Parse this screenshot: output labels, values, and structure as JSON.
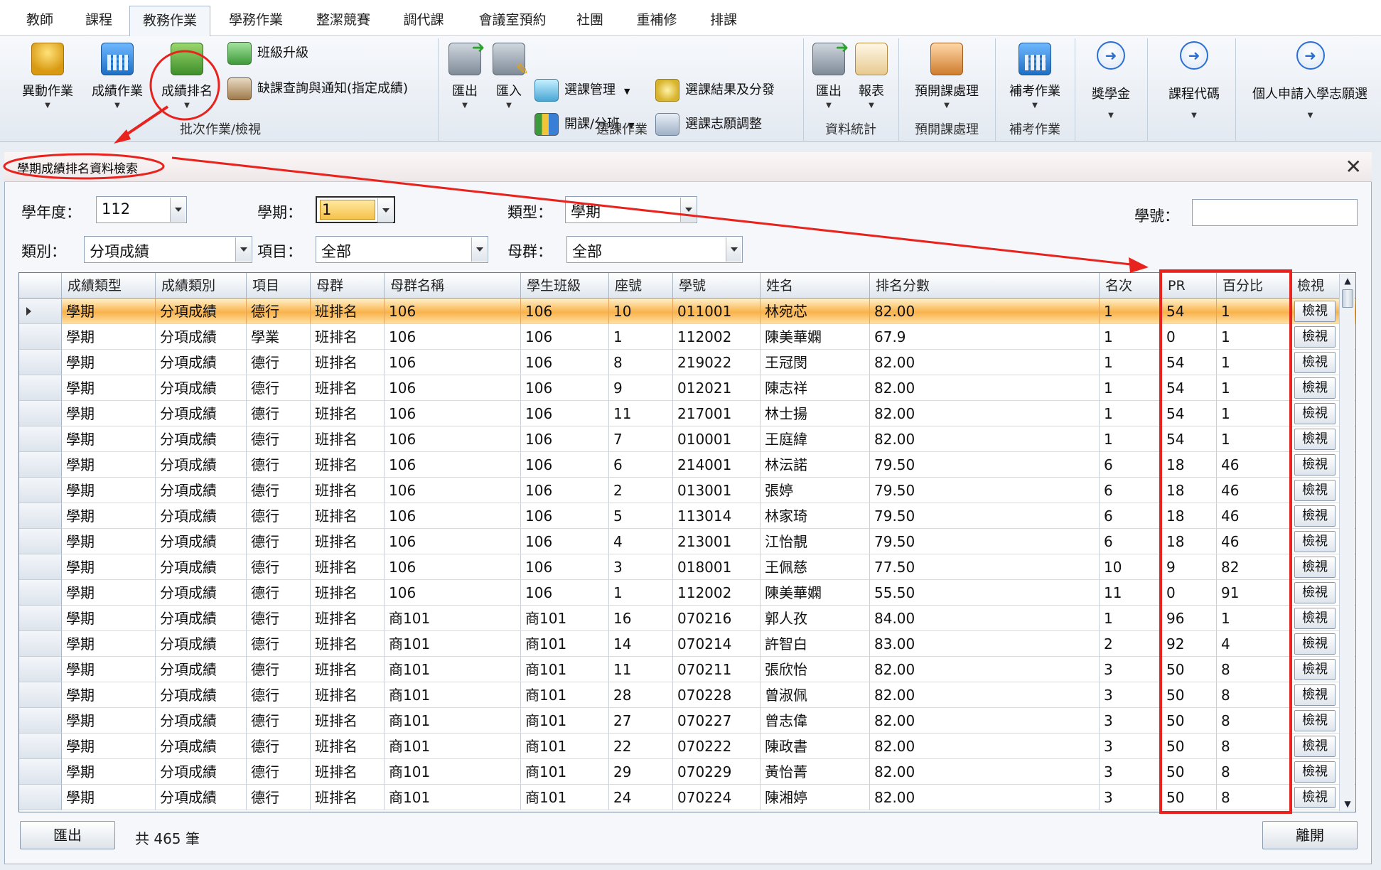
{
  "menu": {
    "tabs": [
      "教師",
      "課程",
      "教務作業",
      "學務作業",
      "整潔競賽",
      "調代課",
      "會議室預約",
      "社團",
      "重補修",
      "排課"
    ],
    "active_index": 2
  },
  "ribbon": {
    "batch_group": {
      "title": "批次作業/檢視",
      "change_op": "異動作業",
      "grade_op": "成績作業",
      "grade_rank": "成績排名",
      "class_promote": "班級升級",
      "absence_query": "缺課查詢與通知(指定成績)"
    },
    "course_group": {
      "title": "選課作業",
      "export": "匯出",
      "import": "匯入",
      "course_manage": "選課管理",
      "open_class": "開課/分班",
      "result_assign": "選課結果及分發",
      "wish_adjust": "選課志願調整"
    },
    "stats_group": {
      "title": "資料統計",
      "export": "匯出",
      "report": "報表"
    },
    "pre_group": {
      "title": "預開課處理",
      "pre_course": "預開課處理"
    },
    "makeup_group": {
      "title": "補考作業",
      "makeup": "補考作業"
    },
    "scholarship": "獎學金",
    "course_code": "課程代碼",
    "personal_apply": "個人申請入學志願選"
  },
  "panel": {
    "title": "學期成績排名資料檢索",
    "filters": {
      "year_label": "學年度：",
      "year_value": "112",
      "semester_label": "學期：",
      "semester_value": "1",
      "type_label": "類型：",
      "type_value": "學期",
      "student_no_label": "學號：",
      "student_no_value": "",
      "category_label": "類別：",
      "category_value": "分項成績",
      "item_label": "項目：",
      "item_value": "全部",
      "parent_label": "母群：",
      "parent_value": "全部"
    },
    "grid": {
      "columns": [
        "成績類型",
        "成績類別",
        "項目",
        "母群",
        "母群名稱",
        "學生班級",
        "座號",
        "學號",
        "姓名",
        "排名分數",
        "名次",
        "PR",
        "百分比",
        "檢視"
      ],
      "view_label": "檢視",
      "rows": [
        [
          "學期",
          "分項成績",
          "德行",
          "班排名",
          "106",
          "106",
          "10",
          "011001",
          "林宛芯",
          "82.00",
          "1",
          "54",
          "1"
        ],
        [
          "學期",
          "分項成績",
          "學業",
          "班排名",
          "106",
          "106",
          "1",
          "112002",
          "陳美華嫻",
          "67.9",
          "1",
          "0",
          "1"
        ],
        [
          "學期",
          "分項成績",
          "德行",
          "班排名",
          "106",
          "106",
          "8",
          "219022",
          "王冠閔",
          "82.00",
          "1",
          "54",
          "1"
        ],
        [
          "學期",
          "分項成績",
          "德行",
          "班排名",
          "106",
          "106",
          "9",
          "012021",
          "陳志祥",
          "82.00",
          "1",
          "54",
          "1"
        ],
        [
          "學期",
          "分項成績",
          "德行",
          "班排名",
          "106",
          "106",
          "11",
          "217001",
          "林士揚",
          "82.00",
          "1",
          "54",
          "1"
        ],
        [
          "學期",
          "分項成績",
          "德行",
          "班排名",
          "106",
          "106",
          "7",
          "010001",
          "王庭緯",
          "82.00",
          "1",
          "54",
          "1"
        ],
        [
          "學期",
          "分項成績",
          "德行",
          "班排名",
          "106",
          "106",
          "6",
          "214001",
          "林沄諾",
          "79.50",
          "6",
          "18",
          "46"
        ],
        [
          "學期",
          "分項成績",
          "德行",
          "班排名",
          "106",
          "106",
          "2",
          "013001",
          "張婷",
          "79.50",
          "6",
          "18",
          "46"
        ],
        [
          "學期",
          "分項成績",
          "德行",
          "班排名",
          "106",
          "106",
          "5",
          "113014",
          "林家琦",
          "79.50",
          "6",
          "18",
          "46"
        ],
        [
          "學期",
          "分項成績",
          "德行",
          "班排名",
          "106",
          "106",
          "4",
          "213001",
          "江怡靚",
          "79.50",
          "6",
          "18",
          "46"
        ],
        [
          "學期",
          "分項成績",
          "德行",
          "班排名",
          "106",
          "106",
          "3",
          "018001",
          "王佩慈",
          "77.50",
          "10",
          "9",
          "82"
        ],
        [
          "學期",
          "分項成績",
          "德行",
          "班排名",
          "106",
          "106",
          "1",
          "112002",
          "陳美華嫻",
          "55.50",
          "11",
          "0",
          "91"
        ],
        [
          "學期",
          "分項成績",
          "德行",
          "班排名",
          "商101",
          "商101",
          "16",
          "070216",
          "郭人孜",
          "84.00",
          "1",
          "96",
          "1"
        ],
        [
          "學期",
          "分項成績",
          "德行",
          "班排名",
          "商101",
          "商101",
          "14",
          "070214",
          "許智白",
          "83.00",
          "2",
          "92",
          "4"
        ],
        [
          "學期",
          "分項成績",
          "德行",
          "班排名",
          "商101",
          "商101",
          "11",
          "070211",
          "張欣怡",
          "82.00",
          "3",
          "50",
          "8"
        ],
        [
          "學期",
          "分項成績",
          "德行",
          "班排名",
          "商101",
          "商101",
          "28",
          "070228",
          "曾淑佩",
          "82.00",
          "3",
          "50",
          "8"
        ],
        [
          "學期",
          "分項成績",
          "德行",
          "班排名",
          "商101",
          "商101",
          "27",
          "070227",
          "曾志偉",
          "82.00",
          "3",
          "50",
          "8"
        ],
        [
          "學期",
          "分項成績",
          "德行",
          "班排名",
          "商101",
          "商101",
          "22",
          "070222",
          "陳政書",
          "82.00",
          "3",
          "50",
          "8"
        ],
        [
          "學期",
          "分項成績",
          "德行",
          "班排名",
          "商101",
          "商101",
          "29",
          "070229",
          "黃怡菁",
          "82.00",
          "3",
          "50",
          "8"
        ],
        [
          "學期",
          "分項成績",
          "德行",
          "班排名",
          "商101",
          "商101",
          "24",
          "070224",
          "陳湘婷",
          "82.00",
          "3",
          "50",
          "8"
        ]
      ]
    },
    "footer": {
      "export": "匯出",
      "count": "共 465 筆",
      "leave": "離開"
    }
  },
  "colors": {
    "annotation_red": "#e8231e",
    "active_row": "#f9b24a"
  }
}
